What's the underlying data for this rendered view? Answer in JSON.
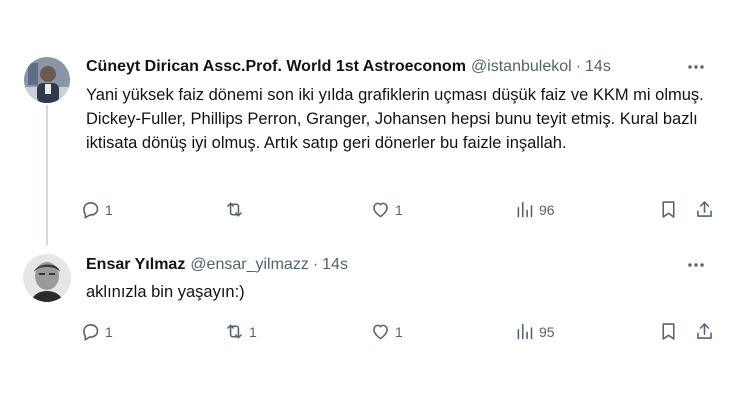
{
  "tweets": [
    {
      "name": "Cüneyt Dirican Assc.Prof. World 1st Astroeconom",
      "handle": "@istanbulekol",
      "time": "14s",
      "text": "Yani yüksek faiz dönemi son iki yılda grafiklerin uçması düşük faiz ve KKM mi olmuş. Dickey-Fuller, Phillips Perron, Granger, Johansen hepsi bunu teyit etmiş. Kural bazlı iktisata dönüş iyi olmuş. Artık satıp geri dönerler bu faizle inşallah.",
      "replies": "1",
      "reposts": "",
      "likes": "1",
      "views": "96"
    },
    {
      "name": "Ensar Yılmaz",
      "handle": "@ensar_yilmazz",
      "time": "14s",
      "text": "aklınızla bin yaşayın:)",
      "replies": "1",
      "reposts": "1",
      "likes": "1",
      "views": "95"
    }
  ],
  "colors": {
    "text": "#0f1419",
    "secondary": "#536471",
    "thread_line": "#cfd9de"
  },
  "icons": [
    "more-icon",
    "reply-icon",
    "repost-icon",
    "like-icon",
    "views-icon",
    "bookmark-icon",
    "share-icon"
  ]
}
